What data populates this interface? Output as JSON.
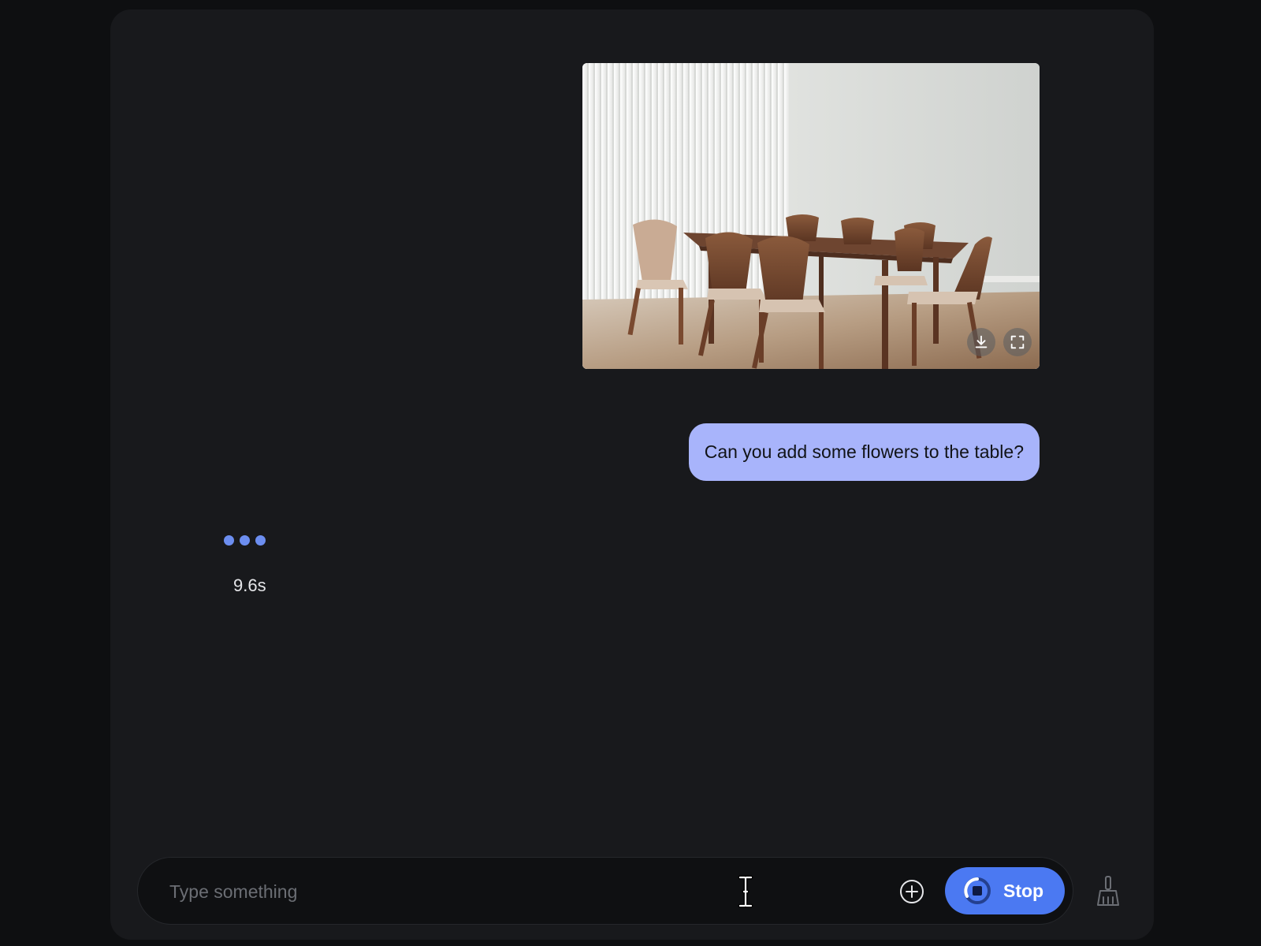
{
  "chat": {
    "image_message": {
      "alt": "Dining room with a wooden table and chairs",
      "actions": {
        "download_icon": "download-icon",
        "fullscreen_icon": "fullscreen-icon"
      }
    },
    "user_message": "Can you add some flowers to the table?",
    "pending_response": {
      "elapsed": "9.6s"
    }
  },
  "composer": {
    "placeholder": "Type something",
    "value": "",
    "add_icon": "plus-circle-icon",
    "stop_label": "Stop",
    "stop_icon": "stop-circle-icon",
    "clear_icon": "broom-icon"
  },
  "colors": {
    "accent": "#4b79f2",
    "user_bubble": "#a8b4fb",
    "typing_dot": "#6c8ef0",
    "panel": "#18191c"
  }
}
